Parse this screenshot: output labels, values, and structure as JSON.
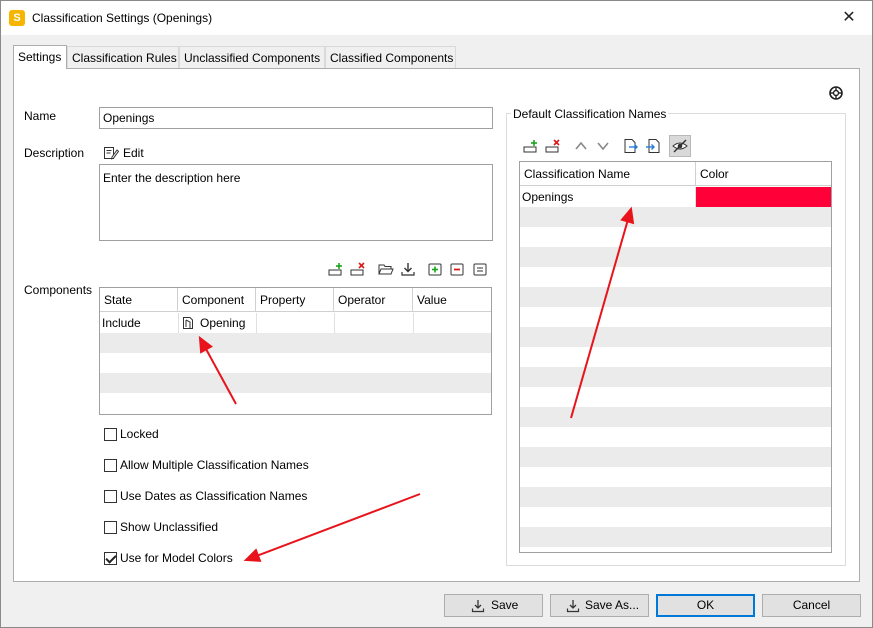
{
  "window": {
    "title": "Classification Settings (Openings)",
    "app_icon_letter": "S",
    "close_glyph": "✕"
  },
  "tabs": [
    {
      "label": "Settings",
      "active": true
    },
    {
      "label": "Classification Rules",
      "active": false
    },
    {
      "label": "Unclassified Components",
      "active": false
    },
    {
      "label": "Classified Components",
      "active": false
    }
  ],
  "settings": {
    "name_label": "Name",
    "name_value": "Openings",
    "description_label": "Description",
    "edit_label": "Edit",
    "description_value": "Enter the description here",
    "components_label": "Components",
    "components_columns": [
      "State",
      "Component",
      "Property",
      "Operator",
      "Value"
    ],
    "components_rows": [
      {
        "state": "Include",
        "component": "Opening",
        "property": "",
        "operator": "",
        "value": ""
      }
    ],
    "checkboxes": [
      {
        "label": "Locked",
        "checked": false
      },
      {
        "label": "Allow Multiple Classification Names",
        "checked": false
      },
      {
        "label": "Use Dates as Classification Names",
        "checked": false
      },
      {
        "label": "Show Unclassified",
        "checked": false
      },
      {
        "label": "Use for Model Colors",
        "checked": true
      }
    ]
  },
  "default_names": {
    "group_title": "Default Classification Names",
    "columns": [
      "Classification Name",
      "Color"
    ],
    "rows": [
      {
        "name": "Openings",
        "color": "#ff0039"
      }
    ]
  },
  "footer": {
    "save_label": "Save",
    "save_as_label": "Save As...",
    "ok_label": "OK",
    "cancel_label": "Cancel"
  },
  "colors": {
    "annotation_arrow": "#e8131b",
    "accent": "#0078d7",
    "row_stripe": "#ebebeb"
  },
  "icons": {
    "help": "help-lifebuoy-icon",
    "component_row": "component-icon"
  }
}
